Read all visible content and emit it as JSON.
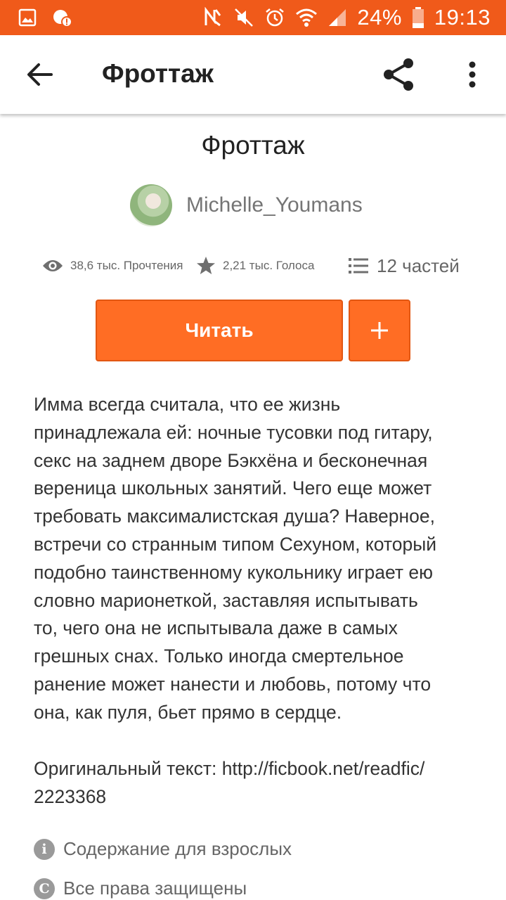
{
  "status_bar": {
    "battery": "24%",
    "time": "19:13",
    "bg_color": "#f05a1a",
    "left_icons": [
      "gallery-icon",
      "shield-alert-icon"
    ],
    "right_icons": [
      "nfc-icon",
      "mute-icon",
      "alarm-icon",
      "wifi-icon",
      "signal-icon",
      "battery-icon"
    ]
  },
  "app_bar": {
    "title": "Фроттаж",
    "icons": [
      "back-arrow-icon",
      "share-icon",
      "more-vert-icon"
    ]
  },
  "story": {
    "title": "Фроттаж",
    "author": "Michelle_Youmans",
    "reads": "38,6 тыс. Прочтения",
    "votes": "2,21 тыс. Голоса",
    "parts": "12 частей",
    "read_label": "Читать",
    "add_label": "+",
    "description": "Имма всегда считала, что ее жизнь\nпринадлежала ей: ночные тусовки под гитару,\nсекс на заднем дворе Бэкхёна и бесконечная\nвереница школьных занятий. Чего еще может\nтребовать максималистская душа? Наверное,\nвстречи со странным типом Сехуном, который\nподобно таинственному кукольнику играет ею\nсловно марионеткой, заставляя испытывать\nто, чего она не испытывала даже в самых\nгрешных снах. Только иногда смертельное\nранение может нанести и любовь, потому что\nона, как пуля, бьет прямо в сердце.",
    "original_text": "Оригинальный текст: http://ficbook.net/readfic/\n2223368",
    "mature_label": "Содержание для взрослых",
    "rights_label": "Все права защищены",
    "accent_color": "#ff6d24"
  }
}
